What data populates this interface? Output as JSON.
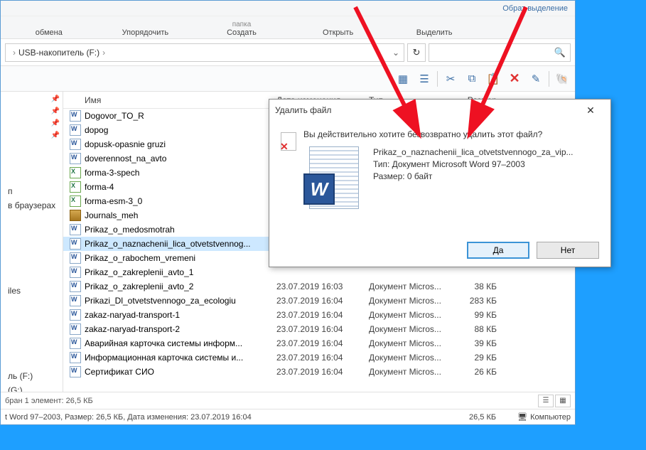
{
  "ribbonTop": {
    "select_cut": "Обрат выделение"
  },
  "ribbon": {
    "exchange": "обмена",
    "organize": "Упорядочить",
    "folder_top": "папка",
    "create": "Создать",
    "open": "Открыть",
    "select": "Выделить"
  },
  "address": {
    "drive": "USB-накопитель (F:)"
  },
  "columns": {
    "name": "Имя",
    "date": "Дата изменения",
    "type": "Тип",
    "size": "Размер"
  },
  "sidebar": {
    "items": [
      {
        "label": "п"
      },
      {
        "label": "в браузерах"
      },
      {
        "label": ""
      },
      {
        "label": "iles"
      },
      {
        "label": ""
      },
      {
        "label": "ль (F:)"
      },
      {
        "label": "(G:)"
      }
    ]
  },
  "files": [
    {
      "name": "Dogovor_TO_R",
      "icon": "doc",
      "date": "",
      "type": "",
      "size": ""
    },
    {
      "name": "dopog",
      "icon": "doc",
      "date": "",
      "type": "",
      "size": ""
    },
    {
      "name": "dopusk-opasnie gruzi",
      "icon": "doc",
      "date": "",
      "type": "",
      "size": ""
    },
    {
      "name": "doverennost_na_avto",
      "icon": "doc",
      "date": "",
      "type": "",
      "size": ""
    },
    {
      "name": "forma-3-spech",
      "icon": "xls",
      "date": "",
      "type": "",
      "size": ""
    },
    {
      "name": "forma-4",
      "icon": "xls",
      "date": "",
      "type": "",
      "size": ""
    },
    {
      "name": "forma-esm-3_0",
      "icon": "xls",
      "date": "",
      "type": "",
      "size": ""
    },
    {
      "name": "Journals_meh",
      "icon": "zip",
      "date": "",
      "type": "",
      "size": ""
    },
    {
      "name": "Prikaz_o_medosmotrah",
      "icon": "doc",
      "date": "",
      "type": "",
      "size": ""
    },
    {
      "name": "Prikaz_o_naznachenii_lica_otvetstvennog...",
      "icon": "doc",
      "date": "",
      "type": "",
      "size": "",
      "selected": true
    },
    {
      "name": "Prikaz_o_rabochem_vremeni",
      "icon": "doc",
      "date": "",
      "type": "",
      "size": ""
    },
    {
      "name": "Prikaz_o_zakreplenii_avto_1",
      "icon": "doc",
      "date": "",
      "type": "",
      "size": ""
    },
    {
      "name": "Prikaz_o_zakreplenii_avto_2",
      "icon": "doc",
      "date": "23.07.2019 16:03",
      "type": "Документ Micros...",
      "size": "38 КБ"
    },
    {
      "name": "Prikazi_Dl_otvetstvennogo_za_ecologiu",
      "icon": "doc",
      "date": "23.07.2019 16:04",
      "type": "Документ Micros...",
      "size": "283 КБ"
    },
    {
      "name": "zakaz-naryad-transport-1",
      "icon": "doc",
      "date": "23.07.2019 16:04",
      "type": "Документ Micros...",
      "size": "99 КБ"
    },
    {
      "name": "zakaz-naryad-transport-2",
      "icon": "doc",
      "date": "23.07.2019 16:04",
      "type": "Документ Micros...",
      "size": "88 КБ"
    },
    {
      "name": "Аварийная карточка системы информ...",
      "icon": "doc",
      "date": "23.07.2019 16:04",
      "type": "Документ Micros...",
      "size": "39 КБ"
    },
    {
      "name": "Информационная карточка системы и...",
      "icon": "doc",
      "date": "23.07.2019 16:04",
      "type": "Документ Micros...",
      "size": "29 КБ"
    },
    {
      "name": "Сертификат СИО",
      "icon": "doc",
      "date": "23.07.2019 16:04",
      "type": "Документ Micros...",
      "size": "26 КБ"
    }
  ],
  "status1": "бран 1 элемент: 26,5 КБ",
  "status2_left": "t Word 97–2003, Размер: 26,5 КБ, Дата изменения: 23.07.2019 16:04",
  "status2_size": "26,5 КБ",
  "status2_comp": "Компьютер",
  "dialog": {
    "title": "Удалить файл",
    "question": "Вы действительно хотите безвозвратно удалить этот файл?",
    "filename": "Prikaz_o_naznachenii_lica_otvetstvennogo_za_vip...",
    "type_line": "Тип: Документ Microsoft Word 97–2003",
    "size_line": "Размер: 0 байт",
    "yes": "Да",
    "no": "Нет"
  }
}
